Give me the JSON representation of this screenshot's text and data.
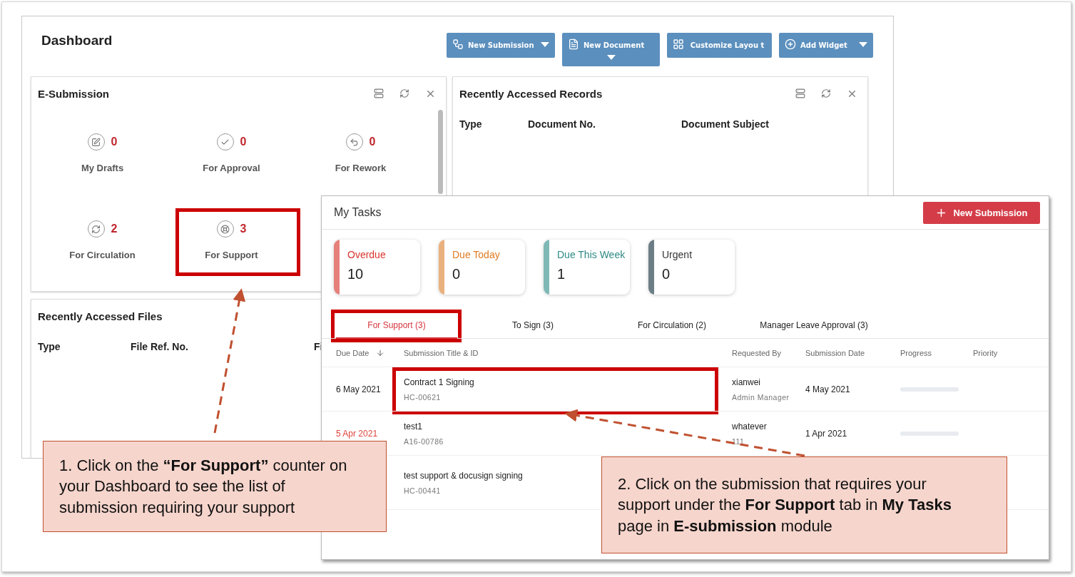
{
  "dashboard": {
    "title": "Dashboard",
    "actions": [
      {
        "label": "New Submission",
        "caret": true
      },
      {
        "label": "New Document",
        "caret": true
      },
      {
        "label": "Customize Layou t",
        "caret": false
      },
      {
        "label": "Add Widget",
        "caret": true
      }
    ],
    "e_submission": {
      "title": "E-Submission",
      "counters": [
        {
          "count": "0",
          "label": "My Drafts"
        },
        {
          "count": "0",
          "label": "For Approval"
        },
        {
          "count": "0",
          "label": "For Rework"
        },
        {
          "count": "2",
          "label": "For Circulation"
        },
        {
          "count": "3",
          "label": "For Support"
        }
      ]
    },
    "recent_records": {
      "title": "Recently Accessed Records",
      "columns": [
        "Type",
        "Document No.",
        "Document Subject"
      ]
    },
    "recent_files": {
      "title": "Recently Accessed Files",
      "columns": [
        "Type",
        "File Ref. No.",
        "Fi"
      ]
    }
  },
  "my_tasks": {
    "title": "My Tasks",
    "new_button": "New Submission",
    "stats": [
      {
        "label": "Overdue",
        "value": "10",
        "color": "#e5807b"
      },
      {
        "label": "Due Today",
        "value": "0",
        "color": "#e9b17e"
      },
      {
        "label": "Due This Week",
        "value": "1",
        "color": "#7fb9b6"
      },
      {
        "label": "Urgent",
        "value": "0",
        "color": "#6c7d86"
      }
    ],
    "tabs": [
      {
        "label": "For Support (3)",
        "selected": true
      },
      {
        "label": "To Sign (3)",
        "selected": false
      },
      {
        "label": "For Circulation (2)",
        "selected": false
      },
      {
        "label": "Manager Leave Approval (3)",
        "selected": false
      }
    ],
    "columns": [
      "Due Date",
      "Submission Title & ID",
      "Requested By",
      "Submission Date",
      "Progress",
      "Priority"
    ],
    "rows": [
      {
        "due": "6 May 2021",
        "overdue": false,
        "title": "Contract 1 Signing",
        "id": "HC-00621",
        "requester": "xianwei",
        "role": "Admin Manager",
        "date": "4 May 2021",
        "level": 0
      },
      {
        "due": "5 Apr 2021",
        "overdue": true,
        "title": "test1",
        "id": "A16-00786",
        "requester": "whatever",
        "role": "111",
        "date": "1 Apr 2021",
        "level": 0
      },
      {
        "title": "test support & docusign signing",
        "id": "HC-00441"
      }
    ]
  },
  "callouts": [
    "1. Click on the **“For Support”** counter on your Dashboard to see the list of submission requiring your support",
    "2. Click on the submission that requires your support under the **For Support** tab in **My Tasks** page in **E-submission** module"
  ]
}
